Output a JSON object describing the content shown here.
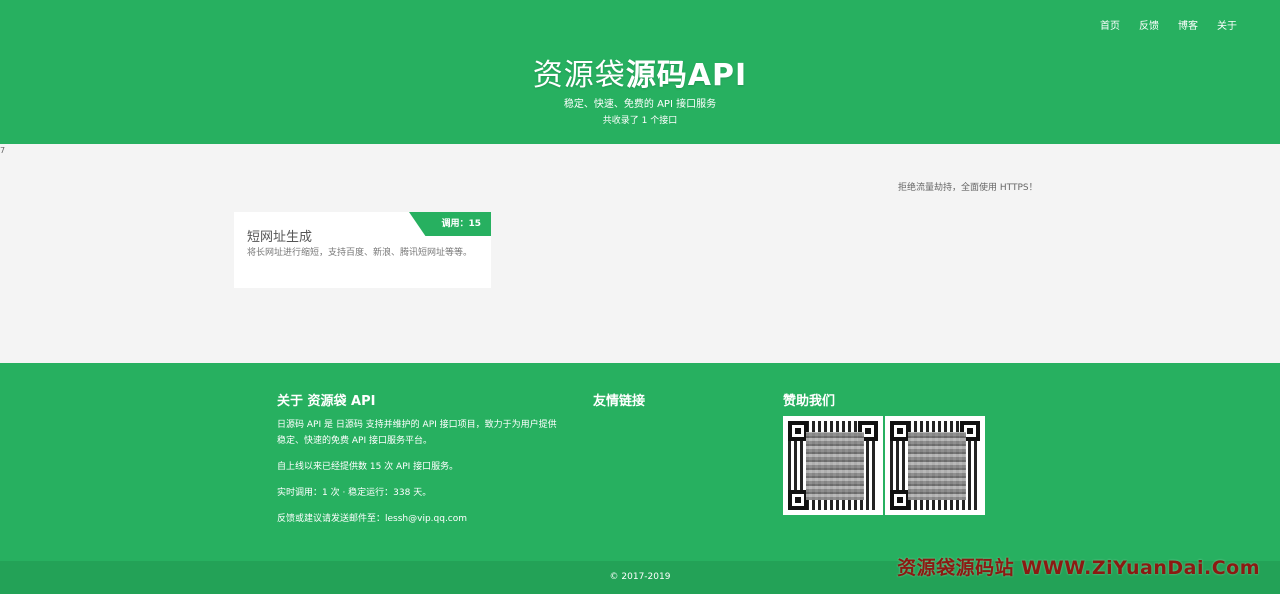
{
  "nav": {
    "items": [
      "首页",
      "反馈",
      "博客",
      "关于"
    ]
  },
  "header": {
    "brand_light": "资源袋",
    "brand_bold": "源码API",
    "slogan": "稳定、快速、免费的 API 接口服务",
    "count": "共收录了 1 个接口"
  },
  "stray_text": "7",
  "notice": "拒绝流量劫持，全面使用 HTTPS！",
  "card": {
    "title": "短网址生成",
    "desc": "将长网址进行缩短，支持百度、新浪、腾讯短网址等等。",
    "badge": "调用：15"
  },
  "footer": {
    "about_title": "关于 资源袋 API",
    "about_p1": "日源码 API 是 日源码 支持并维护的 API 接口项目，致力于为用户提供稳定、快速的免费 API 接口服务平台。",
    "about_p2": "自上线以来已经提供数 15 次 API 接口服务。",
    "about_p3": "实时调用：1 次 · 稳定运行：338 天。",
    "about_p4": "反馈或建议请发送邮件至：lessh@vip.qq.com",
    "links_title": "友情链接",
    "sponsor_title": "赞助我们"
  },
  "copyright": "© 2017-2019",
  "watermark": "资源袋源码站 WWW.ZiYuanDai.Com",
  "colors": {
    "brand_green": "#27b060",
    "background": "#f4f4f4",
    "watermark_red": "#8b1a12"
  }
}
